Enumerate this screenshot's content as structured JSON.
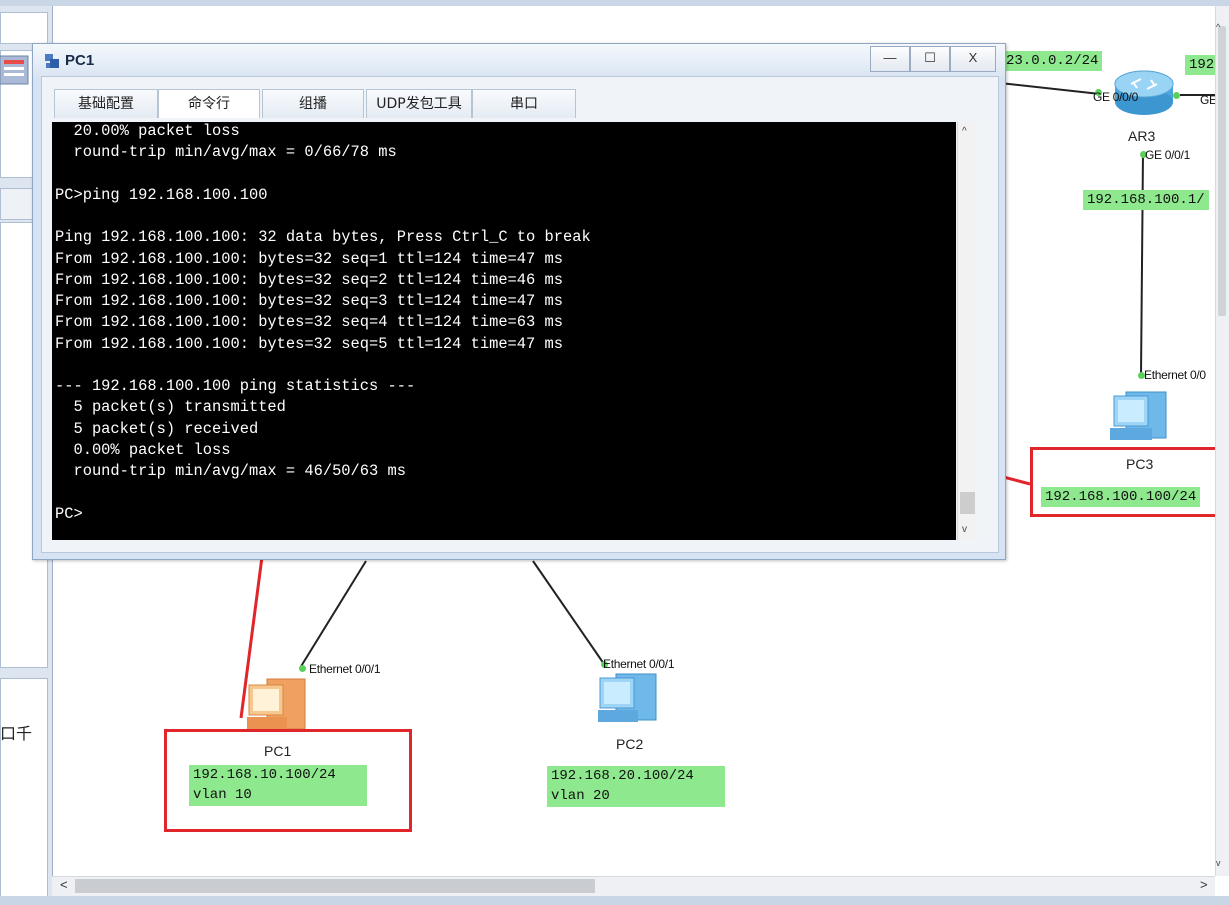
{
  "window": {
    "title": "PC1",
    "minimize_symbol": "—",
    "maximize_symbol": "☐",
    "close_symbol": "X",
    "tabs": [
      {
        "label": "基础配置",
        "active": false
      },
      {
        "label": "命令行",
        "active": true
      },
      {
        "label": "组播",
        "active": false
      },
      {
        "label": "UDP发包工具",
        "active": false
      },
      {
        "label": "串口",
        "active": false
      }
    ]
  },
  "terminal": {
    "lines": [
      "  20.00% packet loss",
      "  round-trip min/avg/max = 0/66/78 ms",
      "",
      "PC>ping 192.168.100.100",
      "",
      "Ping 192.168.100.100: 32 data bytes, Press Ctrl_C to break",
      "From 192.168.100.100: bytes=32 seq=1 ttl=124 time=47 ms",
      "From 192.168.100.100: bytes=32 seq=2 ttl=124 time=46 ms",
      "From 192.168.100.100: bytes=32 seq=3 ttl=124 time=47 ms",
      "From 192.168.100.100: bytes=32 seq=4 ttl=124 time=63 ms",
      "From 192.168.100.100: bytes=32 seq=5 ttl=124 time=47 ms",
      "",
      "--- 192.168.100.100 ping statistics ---",
      "  5 packet(s) transmitted",
      "  5 packet(s) received",
      "  0.00% packet loss",
      "  round-trip min/avg/max = 46/50/63 ms",
      "",
      "PC>"
    ]
  },
  "topology": {
    "labels": {
      "ar3_left_net": "23.0.0.2/24",
      "ar3_right_net": "192",
      "ar3_down_net": "192.168.100.1/",
      "pc3_ip": "192.168.100.100/24",
      "pc1_ip": "192.168.10.100/24",
      "pc1_vlan": "vlan 10",
      "pc2_ip": "192.168.20.100/24",
      "pc2_vlan": "vlan 20"
    },
    "interfaces": {
      "ar3_ge000": "GE 0/0/0",
      "ar3_ge_right": "GE",
      "ar3_ge001": "GE 0/0/1",
      "pc3_eth": "Ethernet 0/0",
      "pc1_eth": "Ethernet 0/0/1",
      "pc2_eth": "Ethernet 0/0/1"
    },
    "devices": {
      "router": "AR3",
      "pc3": "PC3",
      "pc1": "PC1",
      "pc2": "PC2"
    }
  },
  "left_panel": {
    "partial_text": "口千"
  },
  "scrollbars": {
    "left_arrow": "<",
    "right_arrow": ">",
    "up_arrow": "^",
    "down_arrow": "v"
  },
  "colors": {
    "label_green": "#8ee88e",
    "annotation_red": "#e0252b",
    "terminal_bg": "#000000"
  }
}
